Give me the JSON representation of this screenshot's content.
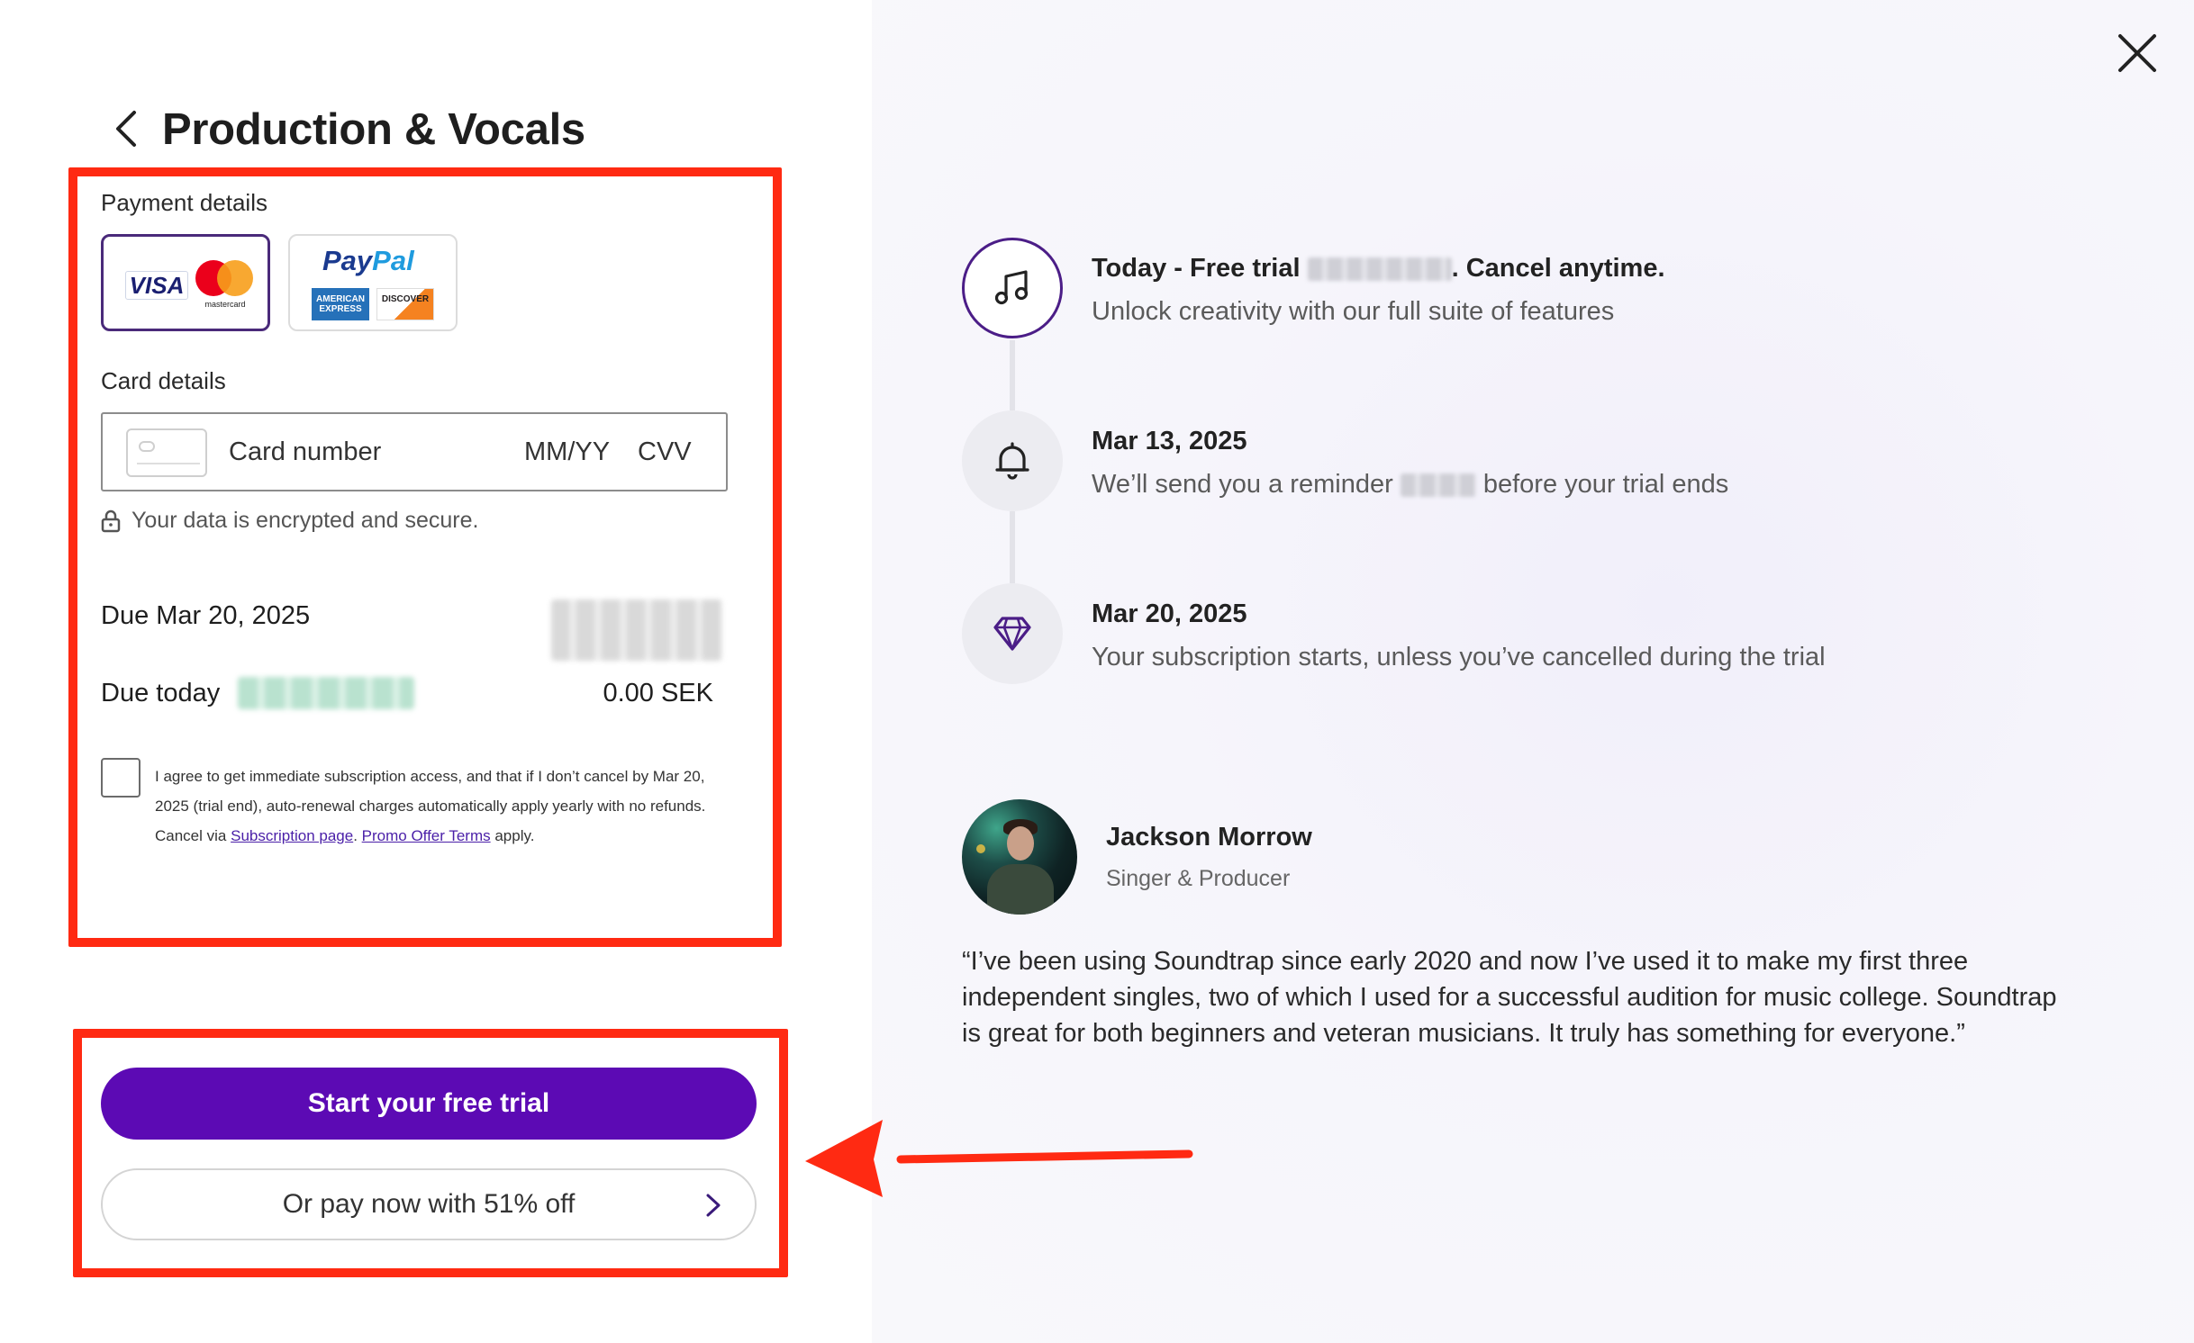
{
  "header": {
    "title": "Production & Vocals",
    "back_icon": "chevron-left-icon"
  },
  "payment": {
    "payment_details_label": "Payment details",
    "methods": {
      "card": {
        "visa": "VISA",
        "mastercard": "mastercard"
      },
      "paypal": {
        "word1": "Pay",
        "word2": "Pal",
        "amex": "AMERICAN EXPRESS",
        "discover": "DISCOVER"
      }
    },
    "card_details_label": "Card details",
    "card_number_placeholder": "Card number",
    "expiry_placeholder": "MM/YY",
    "cvv_placeholder": "CVV",
    "secure_note": "Your data is encrypted and secure."
  },
  "summary": {
    "due_date_label": "Due Mar 20, 2025",
    "due_today_label": "Due today",
    "due_today_amount": "0.00 SEK"
  },
  "terms": {
    "text_before": "I agree to get immediate subscription access, and that if I don’t cancel by Mar 20, 2025 (trial end), auto-renewal charges automatically apply yearly with no refunds. Cancel via ",
    "subscription_link": "Subscription page",
    "separator": ". ",
    "promo_link": "Promo Offer Terms",
    "text_after": " apply."
  },
  "actions": {
    "start_trial": "Start your free trial",
    "pay_now": "Or pay now with 51% off"
  },
  "timeline": [
    {
      "icon": "music-note-icon",
      "title_before": "Today - Free trial ",
      "title_after": ". Cancel anytime.",
      "desc": "Unlock creativity with our full suite of features"
    },
    {
      "icon": "bell-icon",
      "title": "Mar 13, 2025",
      "desc_before": "We’ll send you a reminder ",
      "desc_after": " before your trial ends"
    },
    {
      "icon": "diamond-icon",
      "title": "Mar 20, 2025",
      "desc": "Your subscription starts, unless you’ve cancelled during the trial"
    }
  ],
  "testimonial": {
    "name": "Jackson Morrow",
    "role": "Singer & Producer",
    "quote": "“I’ve been using Soundtrap since early 2020 and now I’ve used it to make my first three independent singles, two of which I used for a successful audition for music college. Soundtrap is great for both beginners and veteran musicians. It truly has something for everyone.”"
  },
  "colors": {
    "primary": "#5c0ab4",
    "annotation_red": "#ff2a12",
    "right_panel_bg": "#f6f5fb"
  }
}
